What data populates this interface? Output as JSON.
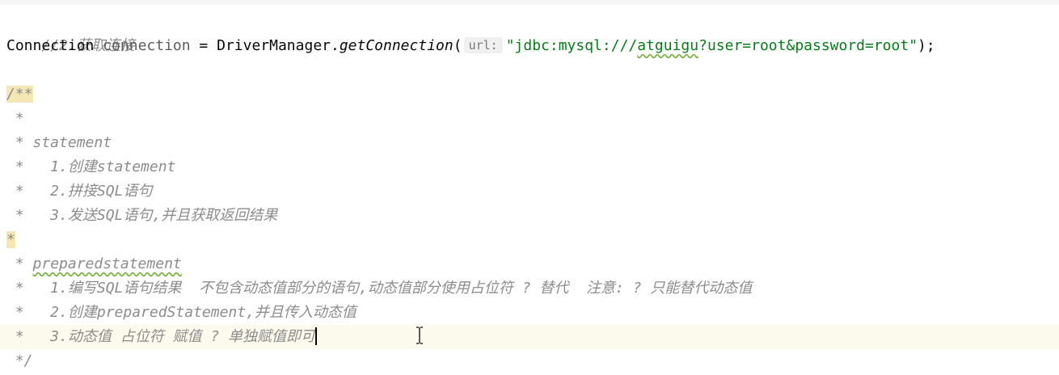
{
  "editor": {
    "lines": {
      "l1": "//2.获取连接",
      "l2": {
        "type": "Connection",
        "var": "connection",
        "eq": " = ",
        "cls": "DriverManager.",
        "method": "getConnection",
        "open": "(",
        "hint": "url:",
        "string_prefix": "\"jdbc:mysql:///",
        "string_db": "atguigu",
        "string_rest": "?user=root&password=root\"",
        "close": ");"
      },
      "l4": "/**",
      "l5": " *",
      "l6": " * statement",
      "l7": " *   1.创建statement",
      "l8": " *   2.拼接SQL语句",
      "l9": " *   3.发送SQL语句,并且获取返回结果",
      "l10": "*",
      "l11_prefix": " * ",
      "l11_word": "preparedstatement",
      "l12": " *   1.编写SQL语句结果  不包含动态值部分的语句,动态值部分使用占位符 ? 替代  注意: ? 只能替代动态值",
      "l13": " *   2.创建preparedStatement,并且传入动态值",
      "l14": " *   3.动态值 占位符 赋值 ? 单独赋值即可",
      "l15": " */"
    }
  }
}
